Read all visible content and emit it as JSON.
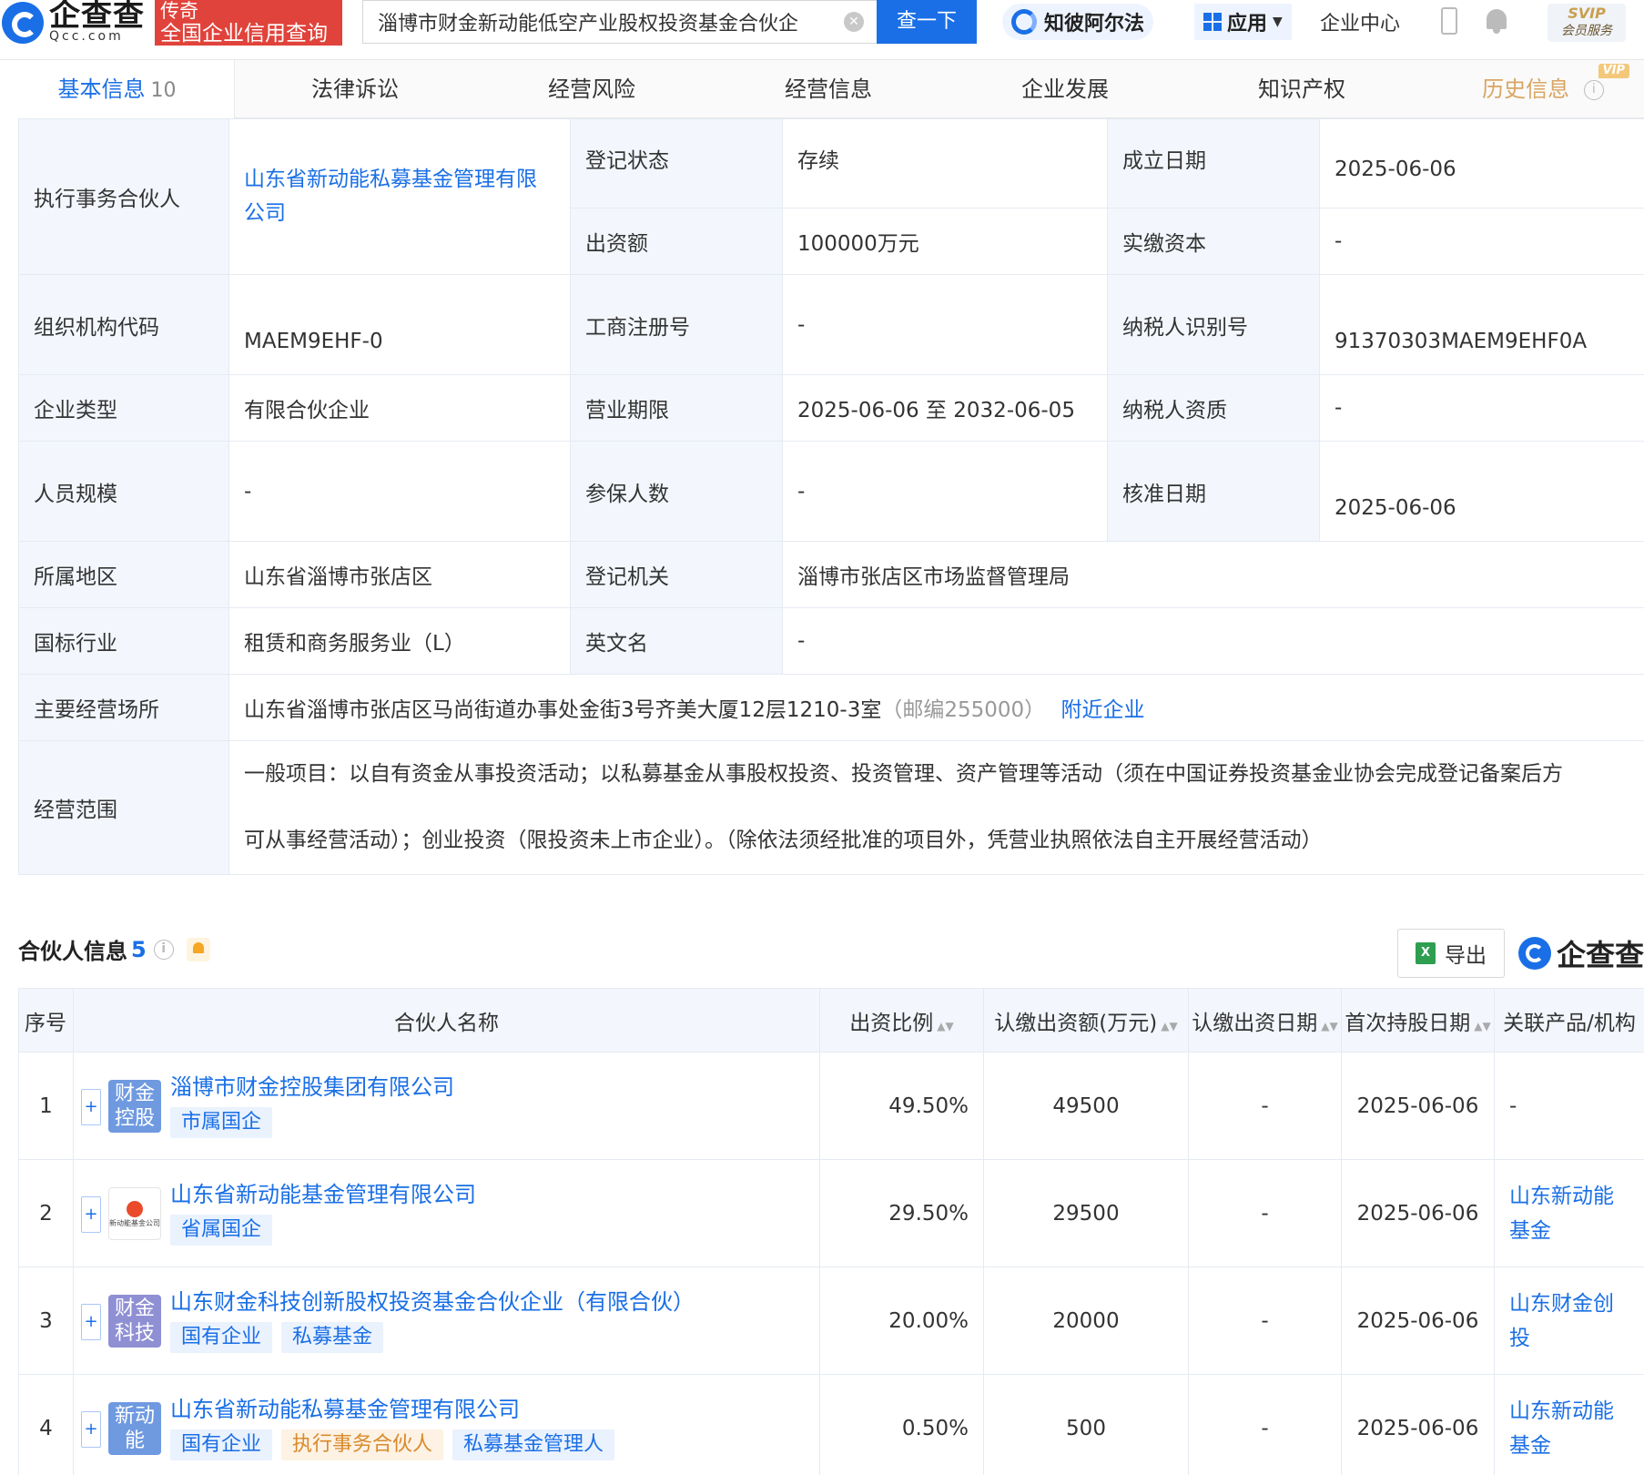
{
  "header": {
    "logo_main": "企查查",
    "logo_sub": "Qcc.com",
    "badge_line1": "传奇",
    "badge_line2": "全国企业信用查询",
    "search_value": "淄博市财金新动能低空产业股权投资基金合伙企",
    "search_button": "查一下",
    "zhibi": "知彼阿尔法",
    "apps": "应用",
    "enterprise_center": "企业中心",
    "svip_line1": "SVIP",
    "svip_line2": "会员服务"
  },
  "tabs": [
    {
      "label": "基本信息",
      "count": "10"
    },
    {
      "label": "法律诉讼"
    },
    {
      "label": "经营风险"
    },
    {
      "label": "经营信息"
    },
    {
      "label": "企业发展"
    },
    {
      "label": "知识产权"
    },
    {
      "label": "历史信息",
      "badge": "VIP"
    }
  ],
  "basic": {
    "managing_partner_label": "执行事务合伙人",
    "managing_partner": "山东省新动能私募基金管理有限公司",
    "status_label": "登记状态",
    "status": "存续",
    "founded_label": "成立日期",
    "founded": "2025-06-06",
    "capital_label": "出资额",
    "capital": "100000万元",
    "paid_label": "实缴资本",
    "paid": "-",
    "org_code_label": "组织机构代码",
    "org_code": "MAEM9EHF-0",
    "reg_no_label": "工商注册号",
    "reg_no": "-",
    "tax_id_label": "纳税人识别号",
    "tax_id": "91370303MAEM9EHF0A",
    "type_label": "企业类型",
    "type": "有限合伙企业",
    "term_label": "营业期限",
    "term": "2025-06-06 至 2032-06-05",
    "tax_qual_label": "纳税人资质",
    "tax_qual": "-",
    "staff_label": "人员规模",
    "staff": "-",
    "insured_label": "参保人数",
    "insured": "-",
    "approved_label": "核准日期",
    "approved": "2025-06-06",
    "region_label": "所属地区",
    "region": "山东省淄博市张店区",
    "authority_label": "登记机关",
    "authority": "淄博市张店区市场监督管理局",
    "industry_label": "国标行业",
    "industry": "租赁和商务服务业（L）",
    "english_label": "英文名",
    "english": "-",
    "address_label": "主要经营场所",
    "address": "山东省淄博市张店区马尚街道办事处金街3号齐美大厦12层1210-3室",
    "postcode": "（邮编255000）",
    "nearby": "附近企业",
    "scope_label": "经营范围",
    "scope_line1": "一般项目：以自有资金从事投资活动；以私募基金从事股权投资、投资管理、资产管理等活动（须在中国证券投资基金业协会完成登记备案后方",
    "scope_line2": "可从事经营活动）；创业投资（限投资未上市企业）。（除依法须经批准的项目外，凭营业执照依法自主开展经营活动）"
  },
  "partners": {
    "title": "合伙人信息",
    "count": "5",
    "export": "导出",
    "brand": "企查查",
    "columns": [
      "序号",
      "合伙人名称",
      "出资比例",
      "认缴出资额(万元)",
      "认缴出资日期",
      "首次持股日期",
      "关联产品/机构"
    ],
    "rows": [
      {
        "no": "1",
        "logo": "财金控股",
        "logo_color": "#6f9ae0",
        "name": "淄博市财金控股集团有限公司",
        "tags": [
          {
            "t": "市属国企",
            "c": "blue"
          }
        ],
        "ratio": "49.50%",
        "amount": "49500",
        "sub_date": "-",
        "first_date": "2025-06-06",
        "rel": "-",
        "rel_link": false
      },
      {
        "no": "2",
        "logo": "",
        "logo_img_text": "新动能基金公司",
        "name": "山东省新动能基金管理有限公司",
        "tags": [
          {
            "t": "省属国企",
            "c": "blue"
          }
        ],
        "ratio": "29.50%",
        "amount": "29500",
        "sub_date": "-",
        "first_date": "2025-06-06",
        "rel": "山东新动能基金",
        "rel_link": true
      },
      {
        "no": "3",
        "logo": "财金科技",
        "logo_color": "#8f8fd4",
        "name": "山东财金科技创新股权投资基金合伙企业（有限合伙）",
        "tags": [
          {
            "t": "国有企业",
            "c": "blue"
          },
          {
            "t": "私募基金",
            "c": "blue"
          }
        ],
        "ratio": "20.00%",
        "amount": "20000",
        "sub_date": "-",
        "first_date": "2025-06-06",
        "rel": "山东财金创投",
        "rel_link": true
      },
      {
        "no": "4",
        "logo": "新动能",
        "logo_color": "#6f9ae0",
        "name": "山东省新动能私募基金管理有限公司",
        "tags": [
          {
            "t": "国有企业",
            "c": "blue"
          },
          {
            "t": "执行事务合伙人",
            "c": "orange"
          },
          {
            "t": "私募基金管理人",
            "c": "blue"
          }
        ],
        "ratio": "0.50%",
        "amount": "500",
        "sub_date": "-",
        "first_date": "2025-06-06",
        "rel": "山东新动能基金",
        "rel_link": true
      }
    ]
  }
}
